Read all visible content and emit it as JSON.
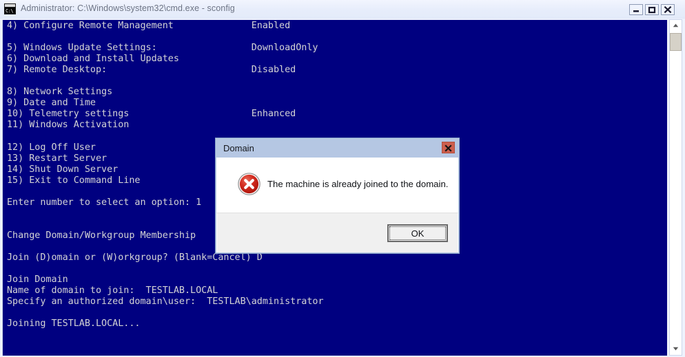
{
  "window": {
    "title": "Administrator: C:\\Windows\\system32\\cmd.exe - sconfig",
    "icon_label": "C:\\",
    "controls": {
      "minimize": "Minimize",
      "maximize": "Maximize",
      "close": "Close"
    }
  },
  "console": {
    "background_color": "#000080",
    "text_color": "#d4d4d4",
    "content": "4) Configure Remote Management              Enabled\n\n5) Windows Update Settings:                 DownloadOnly\n6) Download and Install Updates\n7) Remote Desktop:                          Disabled\n\n8) Network Settings\n9) Date and Time\n10) Telemetry settings                      Enhanced\n11) Windows Activation\n\n12) Log Off User\n13) Restart Server\n14) Shut Down Server\n15) Exit to Command Line\n\nEnter number to select an option: 1\n\n\nChange Domain/Workgroup Membership\n\nJoin (D)omain or (W)orkgroup? (Blank=Cancel) D\n\nJoin Domain\nName of domain to join:  TESTLAB.LOCAL\nSpecify an authorized domain\\user:  TESTLAB\\administrator\n\nJoining TESTLAB.LOCAL...",
    "menu_items": [
      {
        "number": "4)",
        "label": "Configure Remote Management",
        "value": "Enabled"
      },
      {
        "number": "5)",
        "label": "Windows Update Settings:",
        "value": "DownloadOnly"
      },
      {
        "number": "6)",
        "label": "Download and Install Updates",
        "value": ""
      },
      {
        "number": "7)",
        "label": "Remote Desktop:",
        "value": "Disabled"
      },
      {
        "number": "8)",
        "label": "Network Settings",
        "value": ""
      },
      {
        "number": "9)",
        "label": "Date and Time",
        "value": ""
      },
      {
        "number": "10)",
        "label": "Telemetry settings",
        "value": "Enhanced"
      },
      {
        "number": "11)",
        "label": "Windows Activation",
        "value": ""
      },
      {
        "number": "12)",
        "label": "Log Off User",
        "value": ""
      },
      {
        "number": "13)",
        "label": "Restart Server",
        "value": ""
      },
      {
        "number": "14)",
        "label": "Shut Down Server",
        "value": ""
      },
      {
        "number": "15)",
        "label": "Exit to Command Line",
        "value": ""
      }
    ],
    "prompts": {
      "select_option": "Enter number to select an option: 1",
      "section_header": "Change Domain/Workgroup Membership",
      "join_choice": "Join (D)omain or (W)orkgroup? (Blank=Cancel) D",
      "join_domain_header": "Join Domain",
      "domain_name": "Name of domain to join:  TESTLAB.LOCAL",
      "domain_user": "Specify an authorized domain\\user:  TESTLAB\\administrator",
      "joining_status": "Joining TESTLAB.LOCAL..."
    },
    "scrollbar": {
      "up_arrow": "scroll-up",
      "down_arrow": "scroll-down",
      "thumb": "scroll-thumb"
    }
  },
  "dialog": {
    "title": "Domain",
    "message": "The machine is already joined to the domain.",
    "icon": "error-circle-x-icon",
    "icon_color": "#cf2222",
    "ok_label": "OK",
    "close_label": "Close"
  }
}
